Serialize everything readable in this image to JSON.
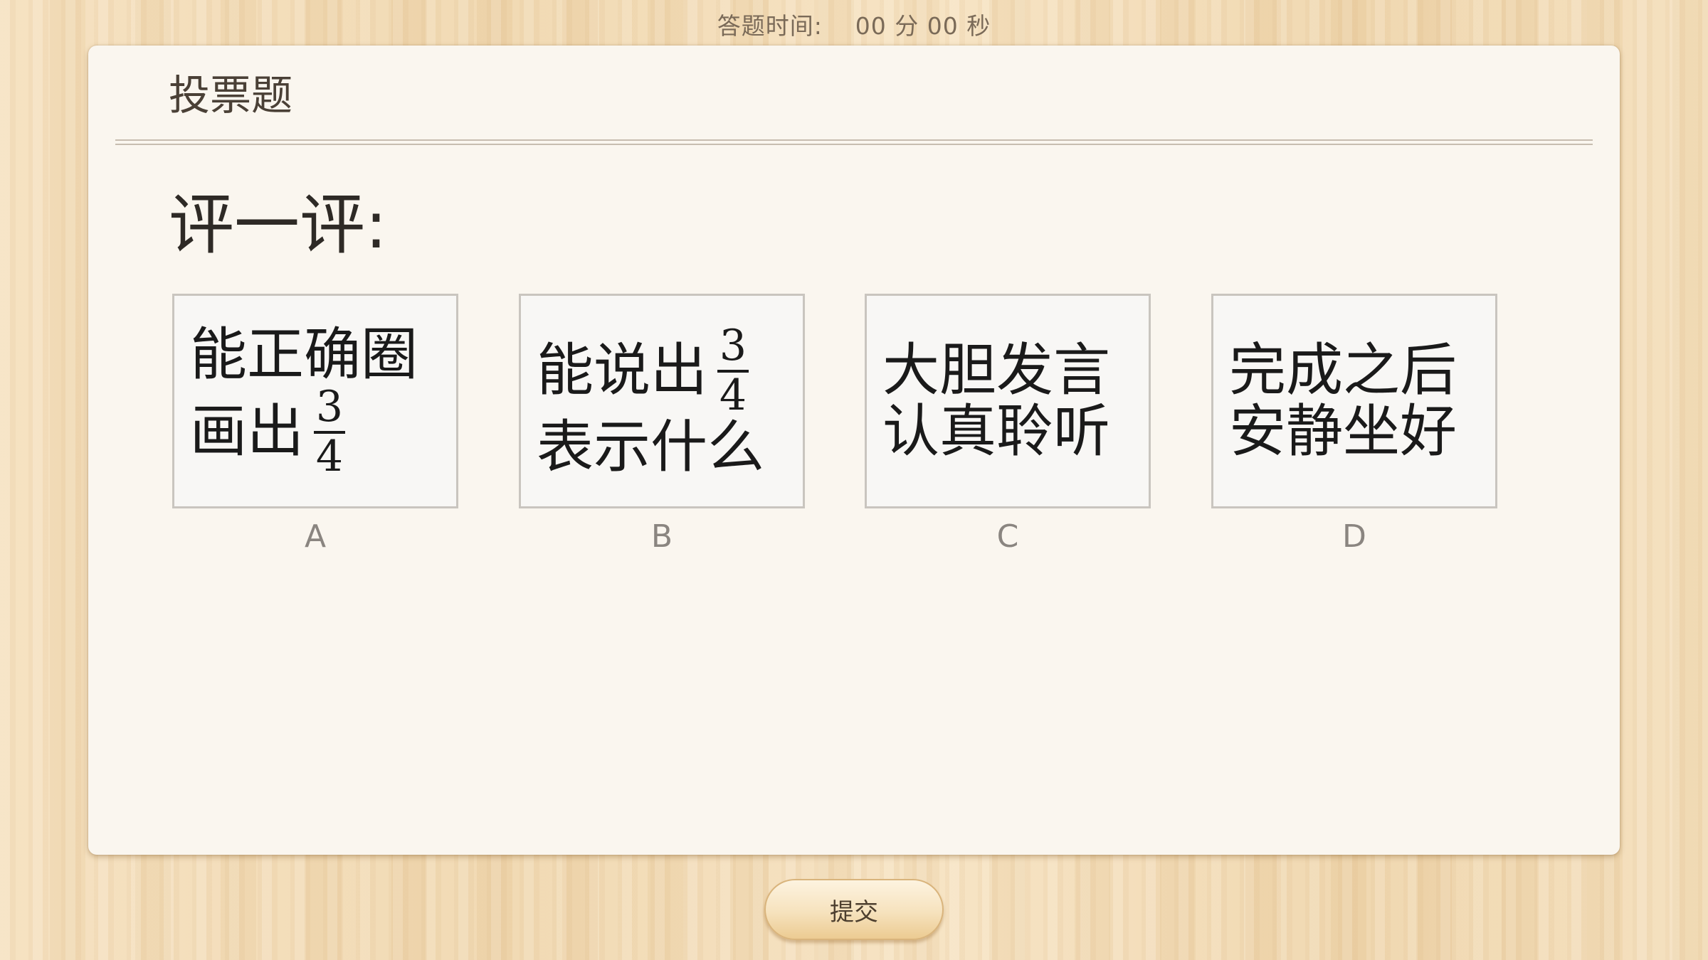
{
  "timer": {
    "label": "答题时间:",
    "minutes": "00",
    "minutes_unit": "分",
    "seconds": "00",
    "seconds_unit": "秒"
  },
  "card": {
    "title": "投票题",
    "question": "评一评:"
  },
  "options": [
    {
      "letter": "A",
      "line1": "能正确圈",
      "line2": "画出",
      "fraction": {
        "numerator": "3",
        "denominator": "4"
      }
    },
    {
      "letter": "B",
      "line1": "能说出",
      "fraction": {
        "numerator": "3",
        "denominator": "4"
      },
      "line2": "表示什么"
    },
    {
      "letter": "C",
      "line1": "大胆发言",
      "line2": "认真聆听"
    },
    {
      "letter": "D",
      "line1": "完成之后",
      "line2": "安静坐好"
    }
  ],
  "submit": {
    "label": "提交"
  }
}
